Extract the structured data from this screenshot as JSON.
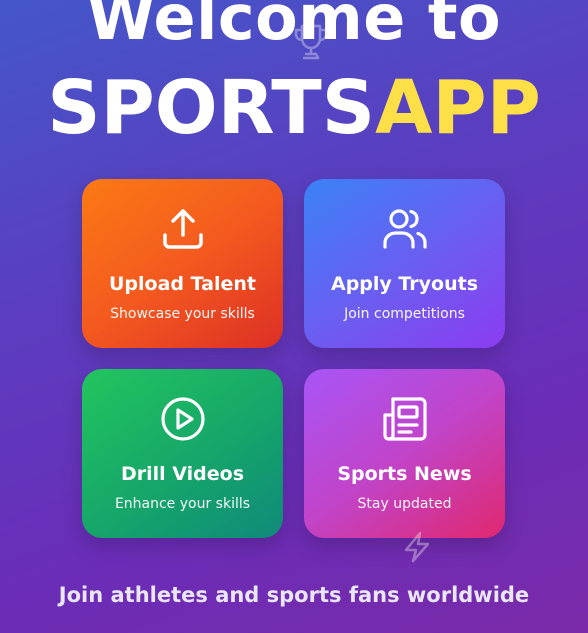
{
  "hero": {
    "line1": "Welcome to",
    "brand_main": "SPORTS",
    "brand_accent": "APP",
    "accent_color": "#fde047"
  },
  "cards": [
    {
      "title": "Upload Talent",
      "subtitle": "Showcase your skills",
      "icon": "upload-icon",
      "colors": [
        "#fb7a14",
        "#dd2f25"
      ]
    },
    {
      "title": "Apply Tryouts",
      "subtitle": "Join competitions",
      "icon": "users-icon",
      "colors": [
        "#3b82f6",
        "#8b3cf0"
      ]
    },
    {
      "title": "Drill Videos",
      "subtitle": "Enhance your skills",
      "icon": "play-circle-icon",
      "colors": [
        "#22c55e",
        "#0f8a7a"
      ]
    },
    {
      "title": "Sports News",
      "subtitle": "Stay updated",
      "icon": "newspaper-icon",
      "colors": [
        "#a855f7",
        "#e0286e"
      ]
    }
  ],
  "footer": {
    "tagline": "Join athletes and sports fans worldwide"
  },
  "decorations": [
    "trophy-icon",
    "lightning-bolt-icon"
  ]
}
